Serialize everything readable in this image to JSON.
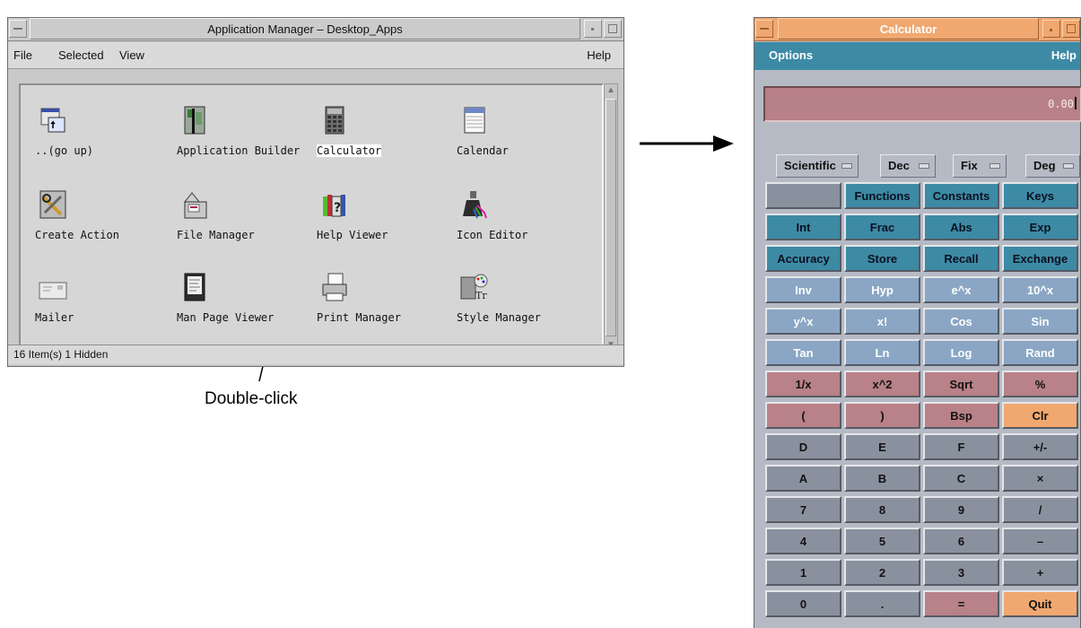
{
  "app_manager": {
    "title": "Application Manager – Desktop_Apps",
    "menu": {
      "file": "File",
      "selected": "Selected",
      "view": "View",
      "help": "Help"
    },
    "status": "16 Item(s) 1 Hidden",
    "apps": [
      {
        "label": "..(go up)",
        "icon": "go-up-icon"
      },
      {
        "label": "Application Builder",
        "icon": "app-builder-icon"
      },
      {
        "label": "Calculator",
        "icon": "calculator-icon",
        "selected": true
      },
      {
        "label": "Calendar",
        "icon": "calendar-icon"
      },
      {
        "label": "Create Action",
        "icon": "create-action-icon"
      },
      {
        "label": "File Manager",
        "icon": "file-manager-icon"
      },
      {
        "label": "Help Viewer",
        "icon": "help-viewer-icon"
      },
      {
        "label": "Icon Editor",
        "icon": "icon-editor-icon"
      },
      {
        "label": "Mailer",
        "icon": "mailer-icon"
      },
      {
        "label": "Man Page Viewer",
        "icon": "man-page-icon"
      },
      {
        "label": "Print Manager",
        "icon": "print-manager-icon"
      },
      {
        "label": "Style Manager",
        "icon": "style-manager-icon"
      }
    ]
  },
  "annotation": {
    "text": "Double-click"
  },
  "calculator": {
    "title": "Calculator",
    "menu": {
      "options": "Options",
      "help": "Help"
    },
    "display": "0.00",
    "modes": [
      "Scientific",
      "Dec",
      "Fix",
      "Deg"
    ],
    "colors": {
      "teal": "#3d8aa5",
      "blue": "#8aa6c4",
      "rose": "#b98188",
      "grey": "#8a919e",
      "orange": "#f0a870"
    },
    "keys": [
      [
        {
          "label": "",
          "style": "blank"
        },
        {
          "label": "Functions",
          "style": "teal"
        },
        {
          "label": "Constants",
          "style": "teal"
        },
        {
          "label": "Keys",
          "style": "teal"
        }
      ],
      [
        {
          "label": "Int",
          "style": "teal"
        },
        {
          "label": "Frac",
          "style": "teal"
        },
        {
          "label": "Abs",
          "style": "teal"
        },
        {
          "label": "Exp",
          "style": "teal"
        }
      ],
      [
        {
          "label": "Accuracy",
          "style": "teal"
        },
        {
          "label": "Store",
          "style": "teal"
        },
        {
          "label": "Recall",
          "style": "teal"
        },
        {
          "label": "Exchange",
          "style": "teal"
        }
      ],
      [
        {
          "label": "Inv",
          "style": "blue"
        },
        {
          "label": "Hyp",
          "style": "blue"
        },
        {
          "label": "e^x",
          "style": "blue"
        },
        {
          "label": "10^x",
          "style": "blue"
        }
      ],
      [
        {
          "label": "y^x",
          "style": "blue"
        },
        {
          "label": "x!",
          "style": "blue"
        },
        {
          "label": "Cos",
          "style": "blue"
        },
        {
          "label": "Sin",
          "style": "blue"
        }
      ],
      [
        {
          "label": "Tan",
          "style": "blue"
        },
        {
          "label": "Ln",
          "style": "blue"
        },
        {
          "label": "Log",
          "style": "blue"
        },
        {
          "label": "Rand",
          "style": "blue"
        }
      ],
      [
        {
          "label": "1/x",
          "style": "rose"
        },
        {
          "label": "x^2",
          "style": "rose"
        },
        {
          "label": "Sqrt",
          "style": "rose"
        },
        {
          "label": "%",
          "style": "rose"
        }
      ],
      [
        {
          "label": "(",
          "style": "rose"
        },
        {
          "label": ")",
          "style": "rose"
        },
        {
          "label": "Bsp",
          "style": "rose"
        },
        {
          "label": "Clr",
          "style": "orange"
        }
      ],
      [
        {
          "label": "D",
          "style": "grey dim"
        },
        {
          "label": "E",
          "style": "grey dim"
        },
        {
          "label": "F",
          "style": "grey dim"
        },
        {
          "label": "+/-",
          "style": "grey"
        }
      ],
      [
        {
          "label": "A",
          "style": "grey dim"
        },
        {
          "label": "B",
          "style": "grey dim"
        },
        {
          "label": "C",
          "style": "grey dim"
        },
        {
          "label": "×",
          "style": "grey"
        }
      ],
      [
        {
          "label": "7",
          "style": "grey"
        },
        {
          "label": "8",
          "style": "grey"
        },
        {
          "label": "9",
          "style": "grey"
        },
        {
          "label": "/",
          "style": "grey"
        }
      ],
      [
        {
          "label": "4",
          "style": "grey"
        },
        {
          "label": "5",
          "style": "grey"
        },
        {
          "label": "6",
          "style": "grey"
        },
        {
          "label": "–",
          "style": "grey"
        }
      ],
      [
        {
          "label": "1",
          "style": "grey"
        },
        {
          "label": "2",
          "style": "grey"
        },
        {
          "label": "3",
          "style": "grey"
        },
        {
          "label": "+",
          "style": "grey"
        }
      ],
      [
        {
          "label": "0",
          "style": "grey"
        },
        {
          "label": ".",
          "style": "grey"
        },
        {
          "label": "=",
          "style": "rose"
        },
        {
          "label": "Quit",
          "style": "orange"
        }
      ]
    ]
  }
}
